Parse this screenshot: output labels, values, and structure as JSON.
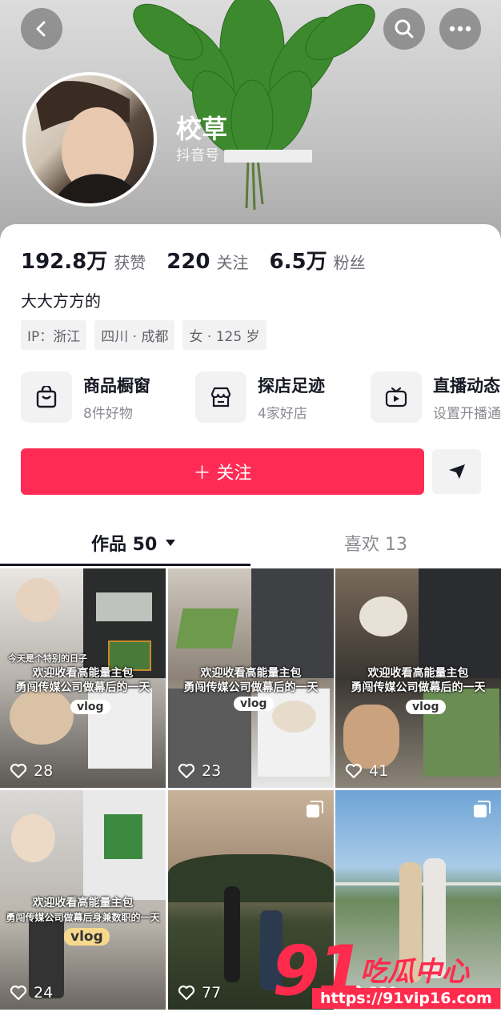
{
  "profile": {
    "name": "校草",
    "douyin_id_label": "抖音号",
    "bio": "大大方方的",
    "tags": [
      "IP：浙江",
      "四川 · 成都",
      "女 · 125 岁"
    ]
  },
  "stats": [
    {
      "value": "192.8万",
      "label": "获赞"
    },
    {
      "value": "220",
      "label": "关注"
    },
    {
      "value": "6.5万",
      "label": "粉丝"
    }
  ],
  "features": [
    {
      "title": "商品橱窗",
      "subtitle": "8件好物",
      "icon": "shopping-bag-icon"
    },
    {
      "title": "探店足迹",
      "subtitle": "4家好店",
      "icon": "store-icon"
    },
    {
      "title": "直播动态",
      "subtitle": "设置开播通知",
      "icon": "tv-icon"
    }
  ],
  "actions": {
    "follow_label": "＋ 关注"
  },
  "tabs": {
    "works_label": "作品 50",
    "likes_label": "喜欢 13"
  },
  "videos": [
    {
      "likes": "28",
      "overlay": [
        "欢迎收看高能量主包",
        "勇闯传媒公司做幕后的一天"
      ],
      "vlog": "vlog",
      "caption": "今天是个特别的日子"
    },
    {
      "likes": "23",
      "overlay": [
        "欢迎收看高能量主包",
        "勇闯传媒公司做幕后的一天"
      ],
      "vlog": "vlog"
    },
    {
      "likes": "41",
      "overlay": [
        "欢迎收看高能量主包",
        "勇闯传媒公司做幕后的一天"
      ],
      "vlog": "vlog"
    },
    {
      "likes": "24",
      "overlay": [
        "欢迎收看高能量主包",
        "勇闯传媒公司做幕后身兼数职的一天"
      ],
      "vlog": "vlog"
    },
    {
      "likes": "77"
    },
    {
      "likes": "229"
    }
  ],
  "watermark": {
    "number": "91",
    "text": "吃瓜中心",
    "url": "https://91vip16.com"
  },
  "colors": {
    "accent": "#fe2c55",
    "text": "#161823",
    "muted": "#8a8b91"
  }
}
